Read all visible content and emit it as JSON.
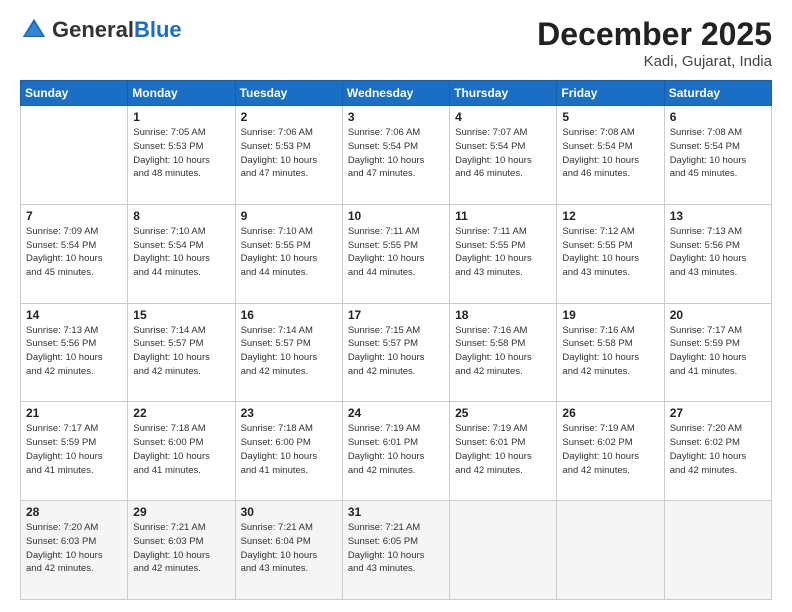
{
  "header": {
    "logo_general": "General",
    "logo_blue": "Blue",
    "month_title": "December 2025",
    "location": "Kadi, Gujarat, India"
  },
  "days_of_week": [
    "Sunday",
    "Monday",
    "Tuesday",
    "Wednesday",
    "Thursday",
    "Friday",
    "Saturday"
  ],
  "weeks": [
    [
      {
        "day": "",
        "info": ""
      },
      {
        "day": "1",
        "info": "Sunrise: 7:05 AM\nSunset: 5:53 PM\nDaylight: 10 hours\nand 48 minutes."
      },
      {
        "day": "2",
        "info": "Sunrise: 7:06 AM\nSunset: 5:53 PM\nDaylight: 10 hours\nand 47 minutes."
      },
      {
        "day": "3",
        "info": "Sunrise: 7:06 AM\nSunset: 5:54 PM\nDaylight: 10 hours\nand 47 minutes."
      },
      {
        "day": "4",
        "info": "Sunrise: 7:07 AM\nSunset: 5:54 PM\nDaylight: 10 hours\nand 46 minutes."
      },
      {
        "day": "5",
        "info": "Sunrise: 7:08 AM\nSunset: 5:54 PM\nDaylight: 10 hours\nand 46 minutes."
      },
      {
        "day": "6",
        "info": "Sunrise: 7:08 AM\nSunset: 5:54 PM\nDaylight: 10 hours\nand 45 minutes."
      }
    ],
    [
      {
        "day": "7",
        "info": "Sunrise: 7:09 AM\nSunset: 5:54 PM\nDaylight: 10 hours\nand 45 minutes."
      },
      {
        "day": "8",
        "info": "Sunrise: 7:10 AM\nSunset: 5:54 PM\nDaylight: 10 hours\nand 44 minutes."
      },
      {
        "day": "9",
        "info": "Sunrise: 7:10 AM\nSunset: 5:55 PM\nDaylight: 10 hours\nand 44 minutes."
      },
      {
        "day": "10",
        "info": "Sunrise: 7:11 AM\nSunset: 5:55 PM\nDaylight: 10 hours\nand 44 minutes."
      },
      {
        "day": "11",
        "info": "Sunrise: 7:11 AM\nSunset: 5:55 PM\nDaylight: 10 hours\nand 43 minutes."
      },
      {
        "day": "12",
        "info": "Sunrise: 7:12 AM\nSunset: 5:55 PM\nDaylight: 10 hours\nand 43 minutes."
      },
      {
        "day": "13",
        "info": "Sunrise: 7:13 AM\nSunset: 5:56 PM\nDaylight: 10 hours\nand 43 minutes."
      }
    ],
    [
      {
        "day": "14",
        "info": "Sunrise: 7:13 AM\nSunset: 5:56 PM\nDaylight: 10 hours\nand 42 minutes."
      },
      {
        "day": "15",
        "info": "Sunrise: 7:14 AM\nSunset: 5:57 PM\nDaylight: 10 hours\nand 42 minutes."
      },
      {
        "day": "16",
        "info": "Sunrise: 7:14 AM\nSunset: 5:57 PM\nDaylight: 10 hours\nand 42 minutes."
      },
      {
        "day": "17",
        "info": "Sunrise: 7:15 AM\nSunset: 5:57 PM\nDaylight: 10 hours\nand 42 minutes."
      },
      {
        "day": "18",
        "info": "Sunrise: 7:16 AM\nSunset: 5:58 PM\nDaylight: 10 hours\nand 42 minutes."
      },
      {
        "day": "19",
        "info": "Sunrise: 7:16 AM\nSunset: 5:58 PM\nDaylight: 10 hours\nand 42 minutes."
      },
      {
        "day": "20",
        "info": "Sunrise: 7:17 AM\nSunset: 5:59 PM\nDaylight: 10 hours\nand 41 minutes."
      }
    ],
    [
      {
        "day": "21",
        "info": "Sunrise: 7:17 AM\nSunset: 5:59 PM\nDaylight: 10 hours\nand 41 minutes."
      },
      {
        "day": "22",
        "info": "Sunrise: 7:18 AM\nSunset: 6:00 PM\nDaylight: 10 hours\nand 41 minutes."
      },
      {
        "day": "23",
        "info": "Sunrise: 7:18 AM\nSunset: 6:00 PM\nDaylight: 10 hours\nand 41 minutes."
      },
      {
        "day": "24",
        "info": "Sunrise: 7:19 AM\nSunset: 6:01 PM\nDaylight: 10 hours\nand 42 minutes."
      },
      {
        "day": "25",
        "info": "Sunrise: 7:19 AM\nSunset: 6:01 PM\nDaylight: 10 hours\nand 42 minutes."
      },
      {
        "day": "26",
        "info": "Sunrise: 7:19 AM\nSunset: 6:02 PM\nDaylight: 10 hours\nand 42 minutes."
      },
      {
        "day": "27",
        "info": "Sunrise: 7:20 AM\nSunset: 6:02 PM\nDaylight: 10 hours\nand 42 minutes."
      }
    ],
    [
      {
        "day": "28",
        "info": "Sunrise: 7:20 AM\nSunset: 6:03 PM\nDaylight: 10 hours\nand 42 minutes."
      },
      {
        "day": "29",
        "info": "Sunrise: 7:21 AM\nSunset: 6:03 PM\nDaylight: 10 hours\nand 42 minutes."
      },
      {
        "day": "30",
        "info": "Sunrise: 7:21 AM\nSunset: 6:04 PM\nDaylight: 10 hours\nand 43 minutes."
      },
      {
        "day": "31",
        "info": "Sunrise: 7:21 AM\nSunset: 6:05 PM\nDaylight: 10 hours\nand 43 minutes."
      },
      {
        "day": "",
        "info": ""
      },
      {
        "day": "",
        "info": ""
      },
      {
        "day": "",
        "info": ""
      }
    ]
  ]
}
